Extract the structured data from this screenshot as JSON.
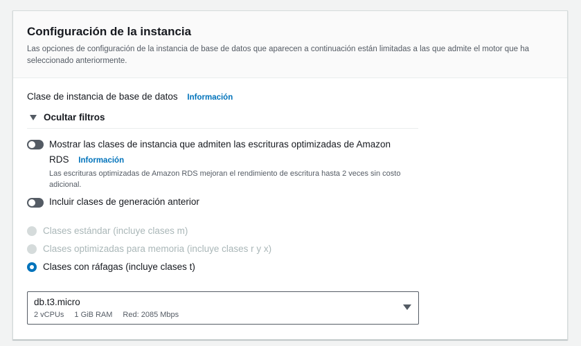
{
  "header": {
    "title": "Configuración de la instancia",
    "description": "Las opciones de configuración de la instancia de base de datos que aparecen a continuación están limitadas a las que admite el motor que ha seleccionado anteriormente."
  },
  "instance_class": {
    "label": "Clase de instancia de base de datos",
    "info_link": "Información"
  },
  "filters": {
    "toggle_label": "Ocultar filtros",
    "optimized_writes": {
      "label_line1": "Mostrar las clases de instancia que admiten las escrituras optimizadas de Amazon",
      "label_line2": "RDS",
      "info_link": "Información",
      "description": "Las escrituras optimizadas de Amazon RDS mejoran el rendimiento de escritura hasta 2 veces sin costo adicional.",
      "enabled": false
    },
    "previous_generation": {
      "label": "Incluir clases de generación anterior",
      "enabled": false
    }
  },
  "class_options": [
    {
      "label": "Clases estándar (incluye clases m)",
      "state": "disabled"
    },
    {
      "label": "Clases optimizadas para memoria (incluye clases r y x)",
      "state": "disabled"
    },
    {
      "label": "Clases con ráfagas (incluye clases t)",
      "state": "selected"
    }
  ],
  "instance_select": {
    "value": "db.t3.micro",
    "vcpus": "2 vCPUs",
    "ram": "1 GiB RAM",
    "network": "Red: 2085 Mbps"
  },
  "colors": {
    "link": "#0073bb",
    "toggle_off": "#545b64",
    "radio_selected": "#0073bb",
    "disabled": "#aab7b8"
  }
}
